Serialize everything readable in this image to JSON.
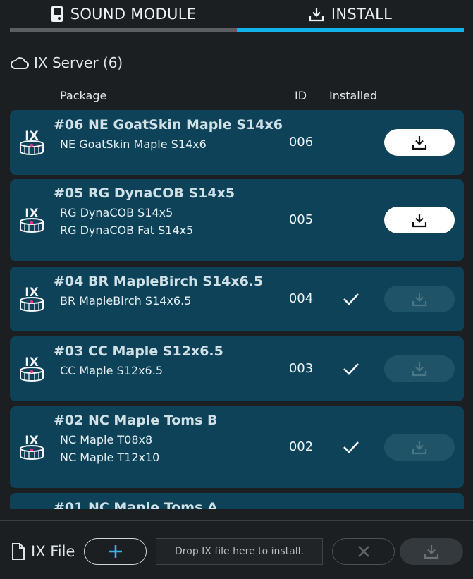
{
  "tabs": [
    {
      "label": "SOUND MODULE",
      "icon": "device-icon",
      "active": false
    },
    {
      "label": "INSTALL",
      "icon": "download-tray-icon",
      "active": true
    }
  ],
  "server": {
    "label": "IX Server (6)",
    "icon": "cloud-icon"
  },
  "columns": {
    "package": "Package",
    "id": "ID",
    "installed": "Installed"
  },
  "packages": [
    {
      "title": "#06 NE GoatSkin Maple S14x6",
      "items": [
        "NE GoatSkin Maple S14x6"
      ],
      "id": "006",
      "installed": false
    },
    {
      "title": "#05 RG DynaCOB S14x5",
      "items": [
        "RG DynaCOB S14x5",
        "RG DynaCOB Fat S14x5"
      ],
      "id": "005",
      "installed": false
    },
    {
      "title": "#04 BR MapleBirch S14x6.5",
      "items": [
        "BR MapleBirch S14x6.5"
      ],
      "id": "004",
      "installed": true
    },
    {
      "title": "#03 CC Maple S12x6.5",
      "items": [
        "CC Maple S12x6.5"
      ],
      "id": "003",
      "installed": true
    },
    {
      "title": "#02 NC Maple Toms B",
      "items": [
        "NC Maple T08x8",
        "NC Maple T12x10"
      ],
      "id": "002",
      "installed": true
    },
    {
      "title": "#01 NC Maple Toms A",
      "items": [],
      "id": "",
      "installed": true
    }
  ],
  "logo_text": "IX",
  "footer": {
    "ix_file_label": "IX File",
    "drop_placeholder": "Drop IX file here to install."
  },
  "colors": {
    "accent": "#12b3e6",
    "row_bg": "#0e4258",
    "background": "#1b1f22"
  }
}
